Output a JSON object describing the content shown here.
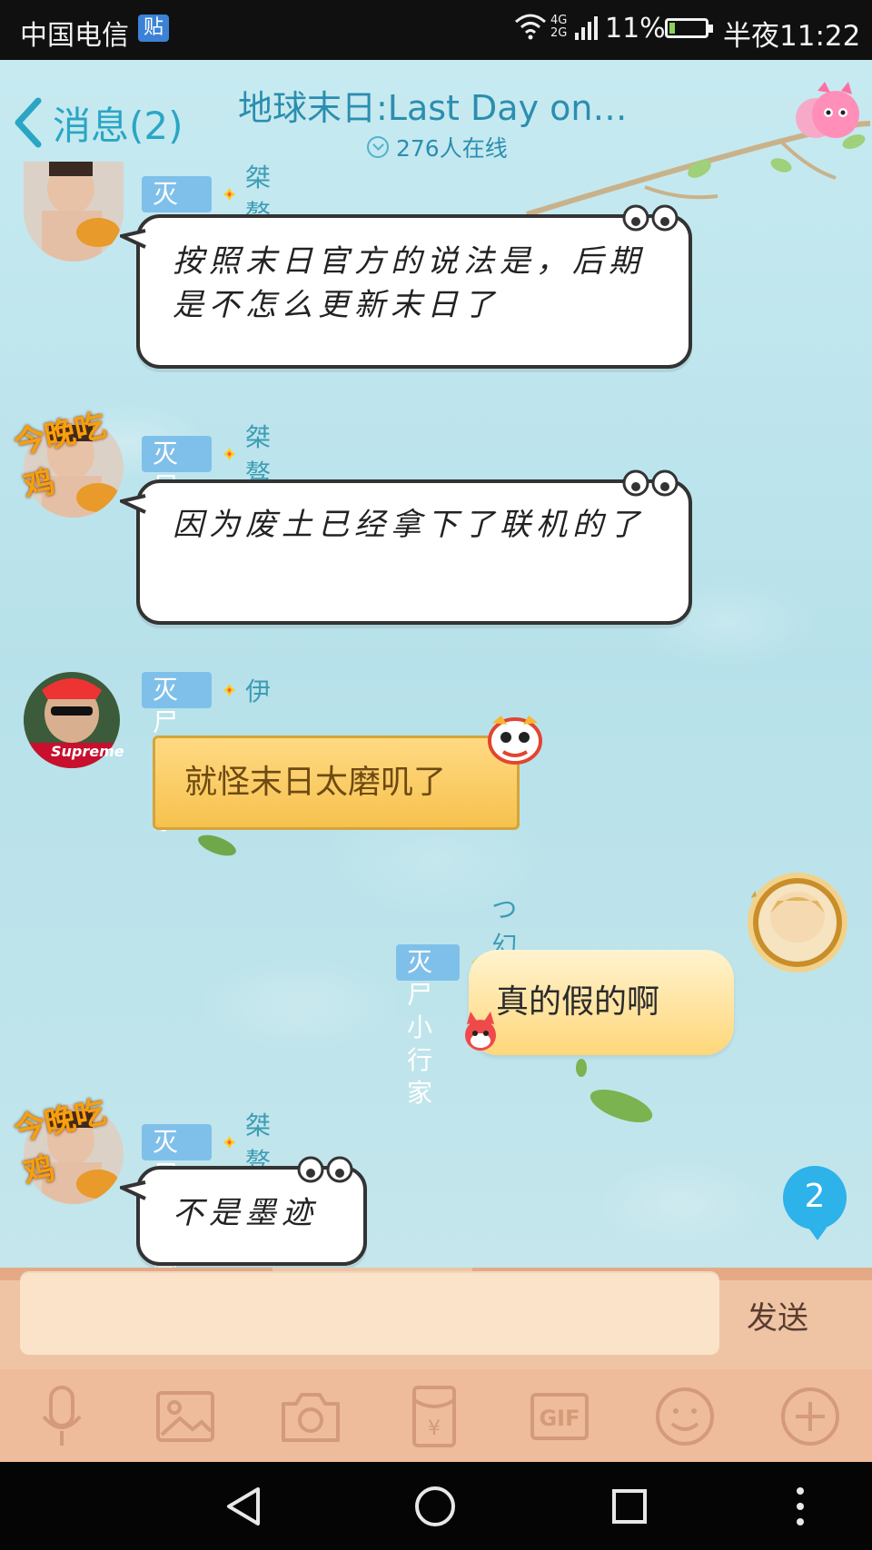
{
  "status_bar": {
    "carrier": "中国电信",
    "badge": "贴",
    "network": "4G\n2G",
    "battery": "11%",
    "time": "半夜11:22"
  },
  "header": {
    "back_label": "消息(2)",
    "title": "地球末日:Last Day on…",
    "online": "276人在线"
  },
  "messages": [
    {
      "title": "灭尸小行家",
      "nick": "桀骜",
      "text": "按照末日官方的说法是，后期是不怎么更新末日了",
      "avatar_caption": "今晚吃鸡"
    },
    {
      "title": "灭尸小行家",
      "nick": "桀骜",
      "text": "因为废土已经拿下了联机的了",
      "avatar_caption": "今晚吃鸡"
    },
    {
      "title": "灭尸小行家",
      "nick": "伊",
      "text": "就怪末日太磨叽了",
      "avatar_caption": "Supreme"
    },
    {
      "title": "灭尸小行家",
      "nick": "つ幻熙丶",
      "text": "真的假的啊"
    },
    {
      "title": "灭尸小行家",
      "nick": "桀骜",
      "text": "不是墨迹",
      "avatar_caption": "今晚吃鸡"
    }
  ],
  "unread_count": "2",
  "input": {
    "placeholder": "",
    "send_label": "发送"
  },
  "toolbar": {
    "items": [
      "microphone-icon",
      "image-icon",
      "camera-icon",
      "red-packet-icon",
      "gif-icon",
      "emoji-icon",
      "plus-icon"
    ],
    "gif_label": "GIF",
    "red_packet_label": "¥"
  },
  "colors": {
    "accent": "#2aa6c4",
    "title_badge": "#7fc0ea",
    "unread": "#2db2ea",
    "input_bar": "#efc4a4"
  }
}
